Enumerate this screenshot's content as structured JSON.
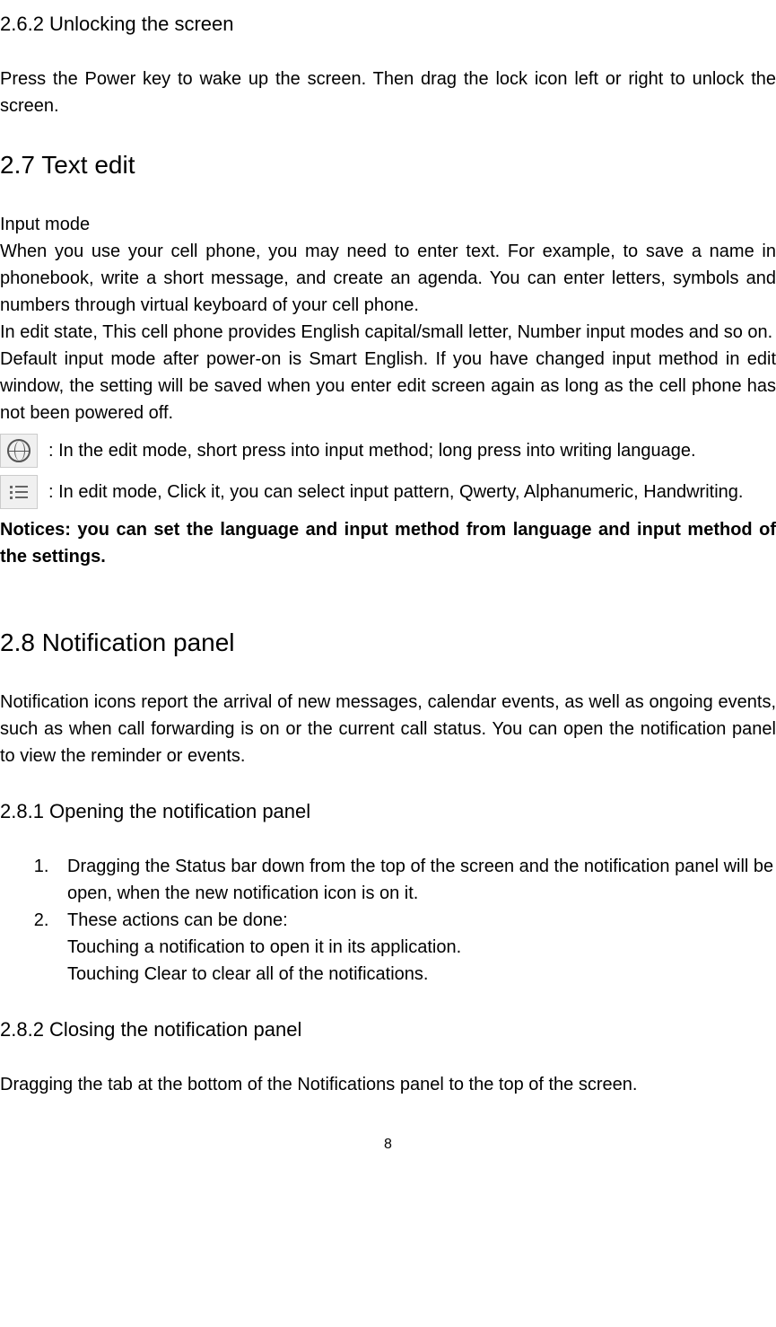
{
  "section_2_6_2": {
    "title": "2.6.2 Unlocking the screen",
    "body": "Press the Power key to wake up the screen. Then drag the lock icon left or right to unlock the screen."
  },
  "section_2_7": {
    "title": "2.7 Text edit",
    "subtitle": "Input mode",
    "p1": "When you use your cell phone, you may need to enter text. For example, to save a name in phonebook, write a short message, and create an agenda. You can enter letters, symbols and numbers through virtual keyboard of your cell phone.",
    "p2": "In edit state, This cell phone provides English capital/small letter, Number input modes and so on.",
    "p3": "Default input mode after power-on is Smart English. If you have changed input method in edit window, the setting will be saved when you enter edit screen again as long as the cell phone has not been powered off.",
    "icon1_text": ": In the edit mode, short press into input method; long press into writing language.",
    "icon2_text": ": In edit mode, Click it, you can select input pattern, Qwerty, Alphanumeric, Handwriting.",
    "notice": "Notices: you can set the language and input method from language and input method of the settings."
  },
  "section_2_8": {
    "title": "2.8 Notification panel",
    "intro": "Notification icons report the arrival of new messages, calendar events, as well as ongoing events, such as when call forwarding is on or the current call status. You can open the notification panel to view the reminder or events."
  },
  "section_2_8_1": {
    "title": "2.8.1 Opening the notification panel",
    "item1": "Dragging the Status bar down from the top of the screen and the notification panel will be open, when the new notification icon is on it.",
    "item2": "These actions can be done:",
    "item2a": "Touching a notification to open it in its application.",
    "item2b": "Touching Clear to clear all of the notifications."
  },
  "section_2_8_2": {
    "title": "2.8.2 Closing the notification panel",
    "body": "Dragging the tab at the bottom of the Notifications panel to the top of the screen."
  },
  "page_number": "8"
}
